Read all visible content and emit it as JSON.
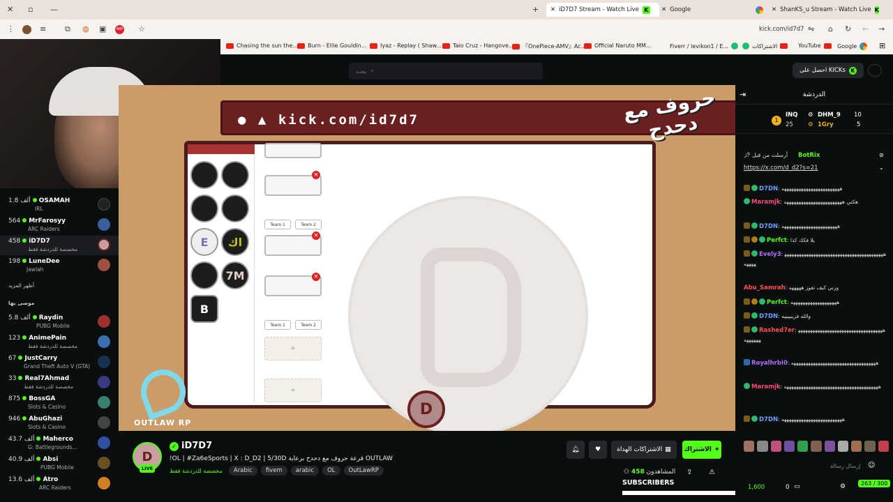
{
  "browser": {
    "tabs": [
      {
        "title": "iD7D7 Stream - Watch Live",
        "active": true
      },
      {
        "title": "Google",
        "active": false
      },
      {
        "title": "ShanKS_u Stream - Watch Live",
        "active": false
      }
    ],
    "url": "kick.com/id7d7",
    "bookmarks": [
      "Chasing the sun the...",
      "Burn - Ellie Gouldin...",
      "Iyaz - Replay ( Shaw...",
      "Taio Cruz - Hangove...",
      "『OnePiece-AMV』Ac...",
      "Official Naruto MM...",
      "Fiverr / levikon1 / E...",
      "الاشتراكات",
      "YouTube",
      "Google"
    ]
  },
  "topbar": {
    "search_placeholder": "بحث",
    "get_kicks": "احصل على KICKs"
  },
  "sidebar": {
    "following": [
      {
        "count": "1.8 ألف",
        "name": "OSAMAH",
        "category": "IRL",
        "color": "#222"
      },
      {
        "count": "564",
        "name": "MrFarosyy",
        "category": "ARC Raiders",
        "color": "#3a5fa0"
      },
      {
        "count": "458",
        "name": "iD7D7",
        "category": "مخصصة للدردشة فقط",
        "color": "#6a2020"
      },
      {
        "count": "198",
        "name": "LuneDee",
        "category": "Jawlah",
        "color": "#a05040"
      }
    ],
    "show_more": "أظهر المزيد",
    "recommended_title": "موصى بها",
    "recommended": [
      {
        "count": "5.8 ألف",
        "name": "Raydin",
        "category": "PUBG Mobile",
        "color": "#a03030"
      },
      {
        "count": "123",
        "name": "AnimePain",
        "category": "مخصصة للدردشة فقط",
        "color": "#3a70b0"
      },
      {
        "count": "67",
        "name": "JustCarry",
        "category": "Grand Theft Auto V (GTA)",
        "color": "#1a3050"
      },
      {
        "count": "33",
        "name": "Real7Ahmad",
        "category": "مخصصة للدردشة فقط",
        "color": "#3a3a80"
      },
      {
        "count": "875",
        "name": "BossGA",
        "category": "Slots & Casino",
        "color": "#3a8070"
      },
      {
        "count": "946",
        "name": "AbuGhazi",
        "category": "Slots & Casino",
        "color": "#444"
      },
      {
        "count": "43.7 ألف",
        "name": "Maherco",
        "category": "G: Battlegrounds...",
        "color": "#3050a0"
      },
      {
        "count": "40.9 ألف",
        "name": "Absi",
        "category": "PUBG Mobile",
        "color": "#6a5020"
      },
      {
        "count": "13.6 ألف",
        "name": "Atro",
        "category": "ARC Raiders",
        "color": "#d08020"
      }
    ]
  },
  "stream": {
    "overlay_url": "kick.com/id7d7",
    "overlay_title": "حروف مع دحدح",
    "watermark": "OUTLAW RP",
    "team1": "Team 1",
    "team2": "Team 2",
    "logos": [
      "E",
      "اك",
      "7M",
      "B"
    ]
  },
  "channel": {
    "name": "iD7D7",
    "live": "LIVE",
    "title": "!OL | #Za6eSports | X : D_D2 | 5/30D قرعة حروف مع دحدح برعاية OUTLAW",
    "category": "مخصصة للدردشة فقط",
    "tags": [
      "Arabic",
      "fivem",
      "arabic",
      "OL",
      "OutLawRP"
    ],
    "gift_subs": "الاشتراكات الهداة",
    "subscribe": "الاشتراك",
    "viewers_count": "458",
    "viewers_label": "المشاهدون",
    "subscribers_label": "SUBSCRIBERS",
    "sub_progress": 0.93
  },
  "chat": {
    "title": "الدردشة",
    "gifters": [
      {
        "name": "INQ",
        "count": "25"
      },
      {
        "name": "DHM_9",
        "count": "10"
      },
      {
        "name": "1Gry",
        "count": "5"
      }
    ],
    "pinned_by": "BotRix",
    "pinned_label": "أرسلت من قبل",
    "pinned_link": "https://x.com/d_d2?s=21",
    "messages": [
      {
        "user": "D7DN",
        "text": "ههههههههههههههههههههههههه",
        "color": "#6aa0ff"
      },
      {
        "user": "Maramjk",
        "text": "هكتي ههههههههههههههههههههههههه",
        "color": "#ff4a7a"
      },
      {
        "user": "D7DN",
        "text": "هههههههههههههههههههههههه",
        "color": "#6aa0ff"
      },
      {
        "user": "Perfct",
        "text": "يلا فكك كذا",
        "color": "#53fc18"
      },
      {
        "user": "Evely3",
        "text": "ههههههههههههههههههههههههههههههههههههههههههههههه",
        "color": "#b070ff"
      },
      {
        "user": "Abu_Samrah",
        "text": "ورني كيف تفوز هههههه",
        "color": "#ff5050"
      },
      {
        "user": "Perfct",
        "text": "هههههههههههههههههههه",
        "color": "#53fc18"
      },
      {
        "user": "D7DN",
        "text": "والله فزيبييييه",
        "color": "#6aa0ff"
      },
      {
        "user": "Rashed7er",
        "text": "ههههههههههههههههههههههههههههههههههههههههههه",
        "color": "#ff5050"
      },
      {
        "user": "Royalhrbi0",
        "text": "هههههههههههههههههههههههههههههههههههه",
        "color": "#b070ff"
      },
      {
        "user": "Maramjk",
        "text": "هههههههههههههههههههههههههههههههههههههههه",
        "color": "#ff4a7a"
      },
      {
        "user": "D7DN",
        "text": "هههههههههههههههههههههههههه",
        "color": "#6aa0ff"
      }
    ],
    "input_placeholder": "إرسال رسالة",
    "points": "1,600",
    "zero": "0",
    "char_count": "263 / 300"
  }
}
